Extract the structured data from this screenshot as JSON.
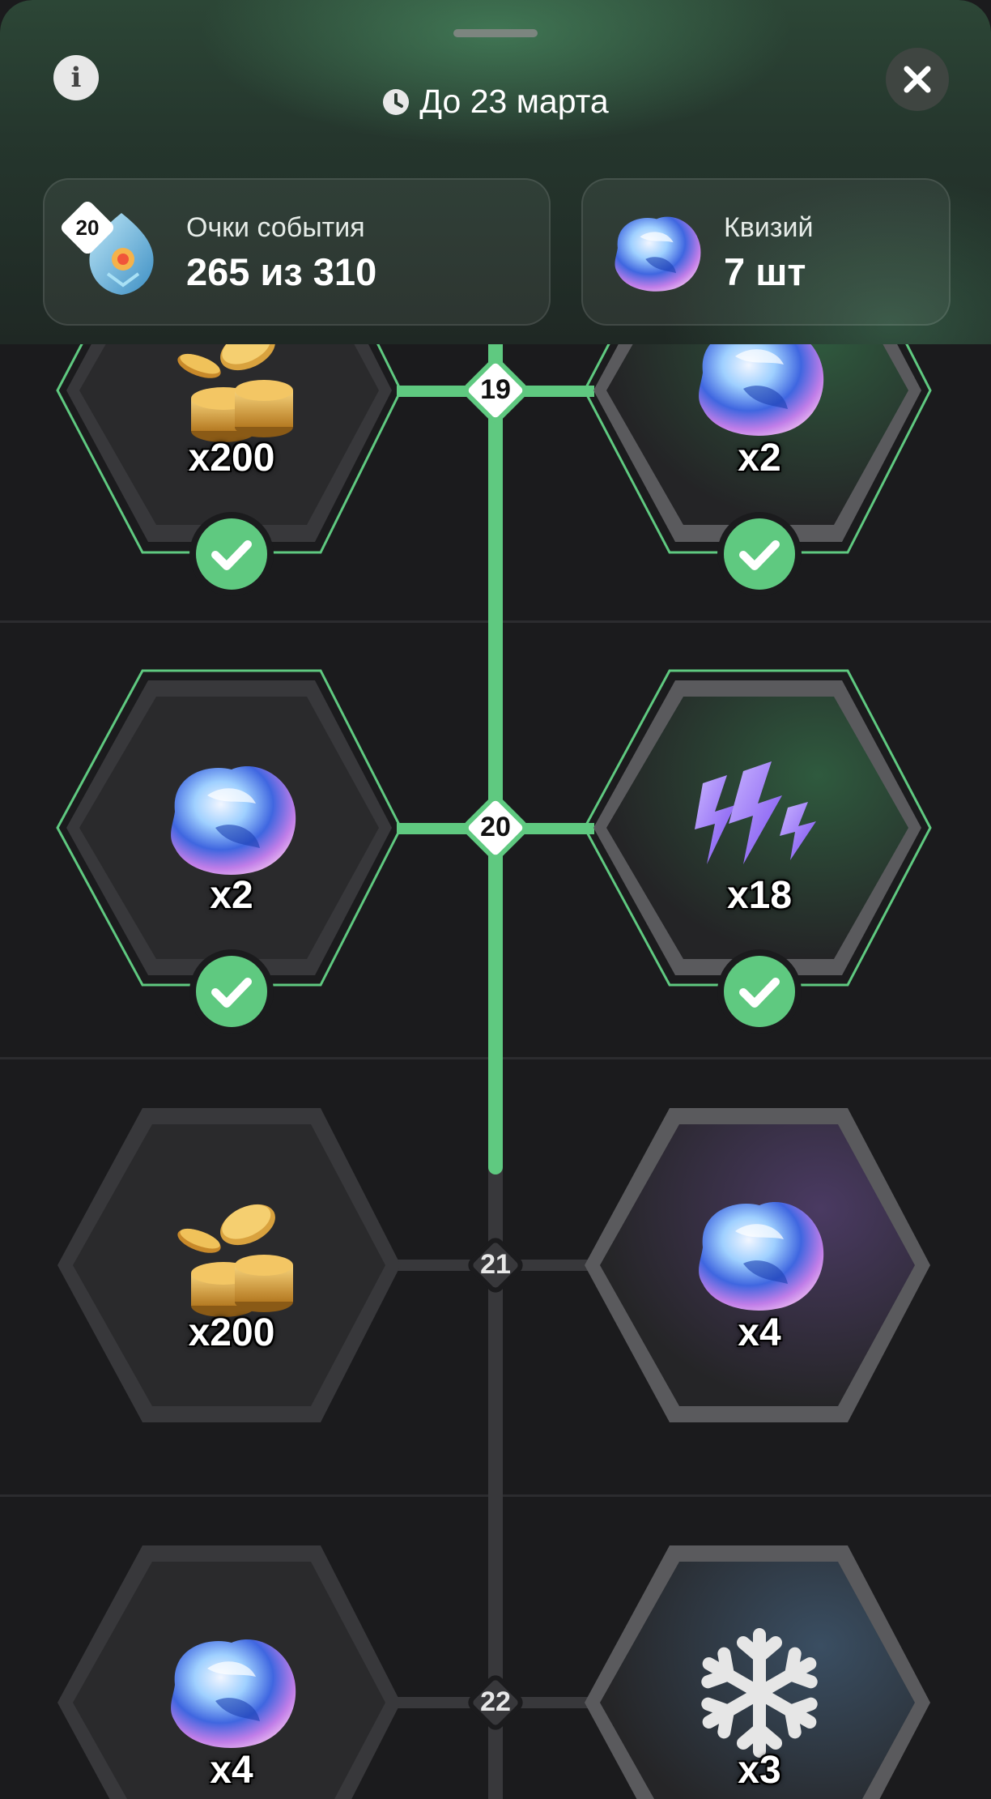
{
  "header": {
    "deadline": "До 23 марта",
    "points_card": {
      "label": "Очки события",
      "value": "265 из 310",
      "level": "20"
    },
    "quiz_card": {
      "label": "Квизий",
      "value": "7 шт"
    }
  },
  "colors": {
    "accent_green": "#5fc980",
    "track_dim": "#38383b",
    "card_bg": "#1b1b1d"
  },
  "levels": [
    {
      "number": "19",
      "left": {
        "item": "coins",
        "qty": "x200",
        "claimed": true
      },
      "right": {
        "item": "crystal",
        "qty": "x2",
        "claimed": true
      }
    },
    {
      "number": "20",
      "left": {
        "item": "crystal",
        "qty": "x2",
        "claimed": true
      },
      "right": {
        "item": "lightning",
        "qty": "x18",
        "claimed": true
      }
    },
    {
      "number": "21",
      "left": {
        "item": "coins",
        "qty": "x200",
        "claimed": false
      },
      "right": {
        "item": "crystal",
        "qty": "x4",
        "claimed": false
      }
    },
    {
      "number": "22",
      "left": {
        "item": "crystal",
        "qty": "x4",
        "claimed": false
      },
      "right": {
        "item": "snowflake",
        "qty": "x3",
        "claimed": false
      }
    }
  ]
}
